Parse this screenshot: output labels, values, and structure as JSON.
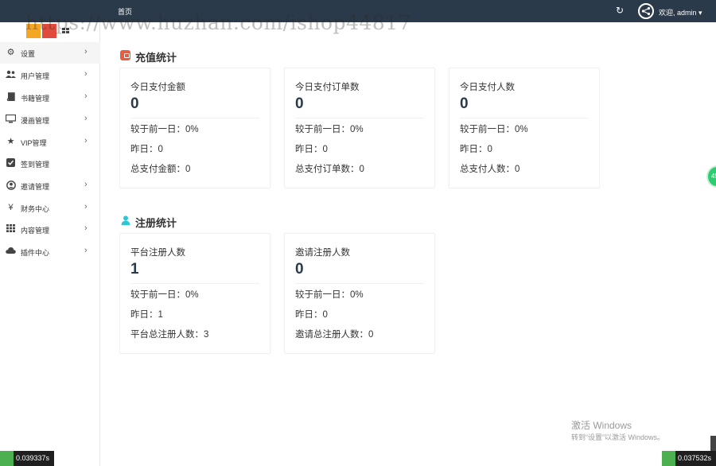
{
  "watermark": "https://www.huzhan.com/ishop44817",
  "topbar": {
    "home_label": "首页",
    "user_label": "欢迎, admin ▾"
  },
  "sidebar": {
    "items": [
      {
        "label": "设置",
        "icon": "gears-icon",
        "has_chevron": true,
        "active": true
      },
      {
        "label": "用户管理",
        "icon": "users-icon",
        "has_chevron": true
      },
      {
        "label": "书籍管理",
        "icon": "book-icon",
        "has_chevron": true
      },
      {
        "label": "漫画管理",
        "icon": "monitor-icon",
        "has_chevron": true
      },
      {
        "label": "VIP管理",
        "icon": "star-icon",
        "has_chevron": true
      },
      {
        "label": "签到管理",
        "icon": "check-square-icon",
        "has_chevron": false
      },
      {
        "label": "邀请管理",
        "icon": "user-circle-icon",
        "has_chevron": true
      },
      {
        "label": "财务中心",
        "icon": "yen-icon",
        "has_chevron": true
      },
      {
        "label": "内容管理",
        "icon": "grid-icon",
        "has_chevron": true
      },
      {
        "label": "插件中心",
        "icon": "cloud-icon",
        "has_chevron": true
      }
    ]
  },
  "recharge": {
    "title": "充值统计",
    "icon_color": "#e85c3f",
    "cards": [
      {
        "title": "今日支付金额",
        "value": "0",
        "compare": "较于前一日：0%",
        "yesterday": "昨日：0",
        "total": "总支付金额：0"
      },
      {
        "title": "今日支付订单数",
        "value": "0",
        "compare": "较于前一日：0%",
        "yesterday": "昨日：0",
        "total": "总支付订单数：0"
      },
      {
        "title": "今日支付人数",
        "value": "0",
        "compare": "较于前一日：0%",
        "yesterday": "昨日：0",
        "total": "总支付人数：0"
      }
    ]
  },
  "register": {
    "title": "注册统计",
    "icon_color": "#2ec6d6",
    "cards": [
      {
        "title": "平台注册人数",
        "value": "1",
        "compare": "较于前一日：0%",
        "yesterday": "昨日：1",
        "total": "平台总注册人数：3"
      },
      {
        "title": "邀请注册人数",
        "value": "0",
        "compare": "较于前一日：0%",
        "yesterday": "昨日：0",
        "total": "邀请总注册人数：0"
      }
    ]
  },
  "windows": {
    "activate": "激活 Windows",
    "sub": "转到“设置”以激活 Windows。"
  },
  "float_button": "45",
  "timers": {
    "left": "0.039337s",
    "right": "0.037532s"
  }
}
